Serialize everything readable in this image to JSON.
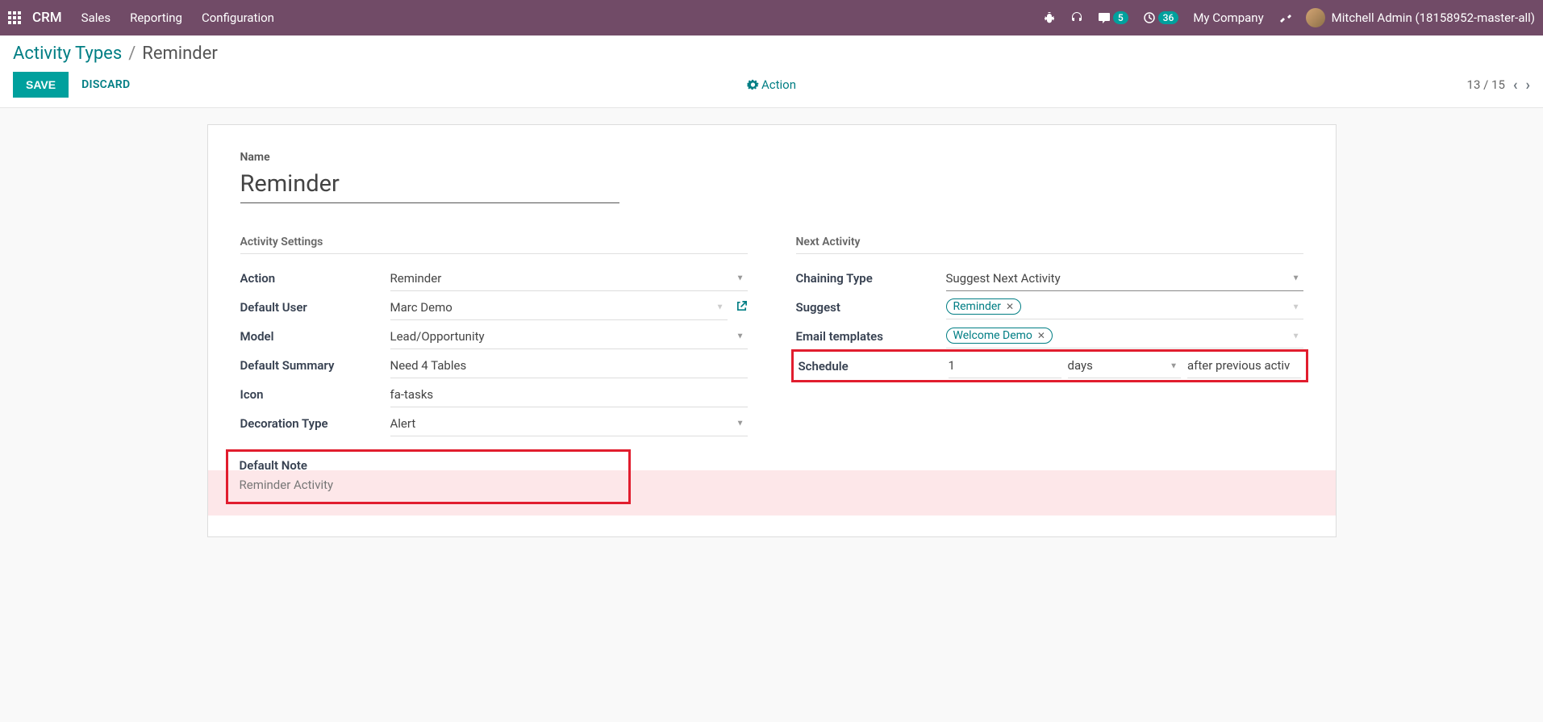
{
  "nav": {
    "brand": "CRM",
    "menu": [
      "Sales",
      "Reporting",
      "Configuration"
    ],
    "msg_count": "5",
    "clock_count": "36",
    "company": "My Company",
    "user": "Mitchell Admin (18158952-master-all)"
  },
  "breadcrumb": {
    "parent": "Activity Types",
    "current": "Reminder"
  },
  "buttons": {
    "save": "SAVE",
    "discard": "DISCARD",
    "action": "Action"
  },
  "pager": {
    "pos": "13",
    "total": "15"
  },
  "form": {
    "name_label": "Name",
    "name_value": "Reminder",
    "left_section": "Activity Settings",
    "right_section": "Next Activity",
    "labels": {
      "action": "Action",
      "default_user": "Default User",
      "model": "Model",
      "default_summary": "Default Summary",
      "icon": "Icon",
      "decoration_type": "Decoration Type",
      "chaining_type": "Chaining Type",
      "suggest": "Suggest",
      "email_templates": "Email templates",
      "schedule": "Schedule"
    },
    "values": {
      "action": "Reminder",
      "default_user": "Marc Demo",
      "model": "Lead/Opportunity",
      "default_summary": "Need 4 Tables",
      "icon": "fa-tasks",
      "decoration_type": "Alert",
      "chaining_type": "Suggest Next Activity",
      "suggest_tag": "Reminder",
      "email_tag": "Welcome Demo",
      "schedule_num": "1",
      "schedule_unit": "days",
      "schedule_after": "after previous activ"
    },
    "note": {
      "title": "Default Note",
      "body": "Reminder Activity"
    }
  }
}
